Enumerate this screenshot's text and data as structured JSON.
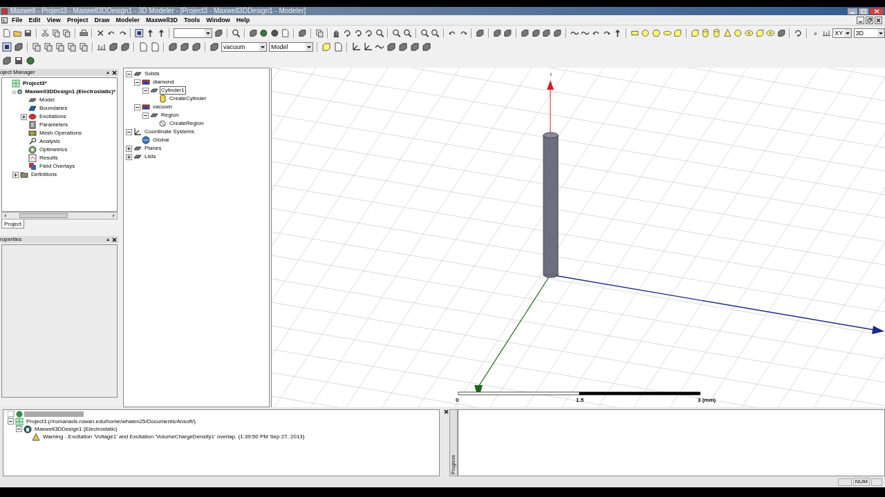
{
  "window": {
    "title": "Maxwell - Project3 - Maxwell3DDesign1 - 3D Modeler - [Project3 - Maxwell3DDesign1 - Modeler]"
  },
  "menu": [
    "File",
    "Edit",
    "View",
    "Project",
    "Draw",
    "Modeler",
    "Maxwell3D",
    "Tools",
    "Window",
    "Help"
  ],
  "toolbar": {
    "material": "vacuum",
    "model_mode": "Model",
    "plane": "XY",
    "view": "3D"
  },
  "project_manager": {
    "title": "oject Manager",
    "tree": [
      {
        "label": "Project3*",
        "kind": "project",
        "children": [
          {
            "label": "Maxwell3DDesign1 (Electrostatic)*",
            "kind": "design",
            "expanded": true,
            "children": [
              {
                "label": "Model",
                "kind": "solid"
              },
              {
                "label": "Boundaries",
                "kind": "boundary"
              },
              {
                "label": "Excitations",
                "kind": "excitation",
                "expanded": false
              },
              {
                "label": "Parameters",
                "kind": "parameter"
              },
              {
                "label": "Mesh Operations",
                "kind": "mesh"
              },
              {
                "label": "Analysis",
                "kind": "analysis"
              },
              {
                "label": "Optimetrics",
                "kind": "optimetrics"
              },
              {
                "label": "Results",
                "kind": "results"
              },
              {
                "label": "Field Overlays",
                "kind": "overlay"
              }
            ]
          },
          {
            "label": "Definitions",
            "kind": "folder",
            "expanded": false
          }
        ]
      }
    ],
    "tabs": [
      {
        "label": "Project",
        "selected": true
      }
    ]
  },
  "properties": {
    "title": "roperties"
  },
  "model_tree": [
    {
      "label": "Solids",
      "kind": "solid",
      "expanded": true,
      "selected": false,
      "children": [
        {
          "label": "diamond",
          "kind": "material",
          "expanded": true,
          "selected": false,
          "children": [
            {
              "label": "Cylinder1",
              "kind": "solid",
              "expanded": true,
              "selected": true,
              "children": [
                {
                  "label": "CreateCylinder",
                  "kind": "operation",
                  "selected": false
                }
              ]
            }
          ]
        },
        {
          "label": "vacuum",
          "kind": "material",
          "expanded": true,
          "selected": false,
          "children": [
            {
              "label": "Region",
              "kind": "solid",
              "expanded": true,
              "selected": false,
              "children": [
                {
                  "label": "CreateRegion",
                  "kind": "region",
                  "selected": false
                }
              ]
            }
          ]
        }
      ]
    },
    {
      "label": "Coordinate Systems",
      "kind": "coords",
      "expanded": true,
      "selected": false,
      "children": [
        {
          "label": "Global",
          "kind": "globe",
          "selected": false
        }
      ]
    },
    {
      "label": "Planes",
      "kind": "solid",
      "expanded": false,
      "selected": false
    },
    {
      "label": "Lists",
      "kind": "solid",
      "expanded": false,
      "selected": false
    }
  ],
  "viewport": {
    "z_label": "z",
    "scale_labels": [
      "0",
      "1.5",
      "3 (mm)"
    ]
  },
  "messages": [
    {
      "label": "Project3 (//romanads.rowan.edu/home/whalen25/Documents/Ansoft/)",
      "kind": "project",
      "expanded": true,
      "children": [
        {
          "label": "Maxwell3DDesign1 (Electrostatic)",
          "kind": "design",
          "expanded": true,
          "children": [
            {
              "label": "Warning - Excitation 'Voltage1' and Excitation 'VolumeChargeDensity1' overlap. (1:39:50 PM  Sep 27, 2013)",
              "kind": "warning"
            }
          ]
        }
      ]
    }
  ],
  "progress": {
    "label": "Progress"
  },
  "status_bar": {
    "num": "NUM"
  }
}
